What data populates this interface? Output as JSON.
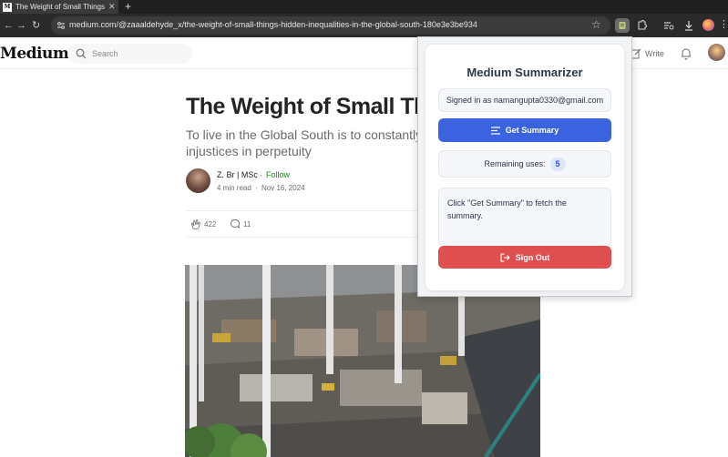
{
  "browser": {
    "tab": {
      "favicon_text": "M",
      "title": "The Weight of Small Things.",
      "close": "✕"
    },
    "new_tab": "+",
    "url": "medium.com/@zaaaldehyde_x/the-weight-of-small-things-hidden-inequalities-in-the-global-south-180e3e3be934",
    "nav": {
      "back": "←",
      "forward": "→",
      "reload": "↻"
    }
  },
  "medium": {
    "logo": "Medium",
    "search_placeholder": "Search",
    "write_label": "Write"
  },
  "article": {
    "title": "The Weight of Small Thi",
    "subtitle": "To live in the Global South is to constantly exp injustices in perpetuity",
    "author": "Z. Br | MSc",
    "dot": "·",
    "follow": "Follow",
    "read_time": "4 min read",
    "date": "Nov 16, 2024",
    "claps": "422",
    "responses": "11"
  },
  "popup": {
    "title": "Medium Summarizer",
    "signed_in": "Signed in as namangupta0330@gmail.com",
    "get_summary": "Get Summary",
    "remaining_label": "Remaining uses:",
    "remaining_count": "5",
    "summary_placeholder": "Click \"Get Summary\" to fetch the summary.",
    "sign_out": "Sign Out"
  },
  "colors": {
    "primary": "#3b63e0",
    "danger": "#e04f4f",
    "follow": "#1a8917"
  }
}
